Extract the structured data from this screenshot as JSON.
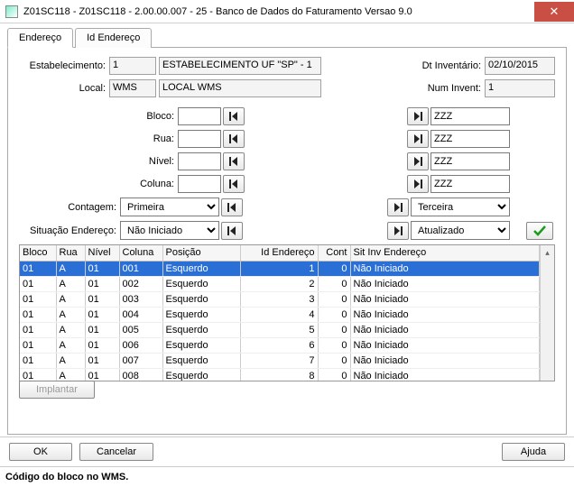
{
  "window": {
    "title": "Z01SC118 - Z01SC118 - 2.00.00.007 - 25 - Banco de Dados do Faturamento Versao 9.0"
  },
  "tabs": {
    "endereco": "Endereço",
    "id_endereco": "Id Endereço"
  },
  "labels": {
    "estabelecimento": "Estabelecimento:",
    "local": "Local:",
    "dt_inventario": "Dt Inventário:",
    "num_invent": "Num Invent:",
    "bloco": "Bloco:",
    "rua": "Rua:",
    "nivel": "Nível:",
    "coluna": "Coluna:",
    "contagem": "Contagem:",
    "situacao": "Situação Endereço:"
  },
  "values": {
    "estabelecimento_cod": "1",
    "estabelecimento_nome": "ESTABELECIMENTO UF \"SP\" - 1",
    "local_cod": "WMS",
    "local_nome": "LOCAL WMS",
    "dt_inventario": "02/10/2015",
    "num_invent": "1",
    "bloco_from": "",
    "bloco_to": "ZZZ",
    "rua_from": "",
    "rua_to": "ZZZ",
    "nivel_from": "",
    "nivel_to": "ZZZ",
    "coluna_from": "",
    "coluna_to": "ZZZ",
    "contagem_from": "Primeira",
    "contagem_to": "Terceira",
    "situacao_from": "Não Iniciado",
    "situacao_to": "Atualizado"
  },
  "table": {
    "headers": {
      "bloco": "Bloco",
      "rua": "Rua",
      "nivel": "Nível",
      "coluna": "Coluna",
      "posicao": "Posição",
      "id_endereco": "Id Endereço",
      "cont": "Cont",
      "sit_inv": "Sit Inv Endereço"
    },
    "rows": [
      {
        "bloco": "01",
        "rua": "A",
        "nivel": "01",
        "coluna": "001",
        "posicao": "Esquerdo",
        "id": "1",
        "cont": "0",
        "sit": "Não Iniciado"
      },
      {
        "bloco": "01",
        "rua": "A",
        "nivel": "01",
        "coluna": "002",
        "posicao": "Esquerdo",
        "id": "2",
        "cont": "0",
        "sit": "Não Iniciado"
      },
      {
        "bloco": "01",
        "rua": "A",
        "nivel": "01",
        "coluna": "003",
        "posicao": "Esquerdo",
        "id": "3",
        "cont": "0",
        "sit": "Não Iniciado"
      },
      {
        "bloco": "01",
        "rua": "A",
        "nivel": "01",
        "coluna": "004",
        "posicao": "Esquerdo",
        "id": "4",
        "cont": "0",
        "sit": "Não Iniciado"
      },
      {
        "bloco": "01",
        "rua": "A",
        "nivel": "01",
        "coluna": "005",
        "posicao": "Esquerdo",
        "id": "5",
        "cont": "0",
        "sit": "Não Iniciado"
      },
      {
        "bloco": "01",
        "rua": "A",
        "nivel": "01",
        "coluna": "006",
        "posicao": "Esquerdo",
        "id": "6",
        "cont": "0",
        "sit": "Não Iniciado"
      },
      {
        "bloco": "01",
        "rua": "A",
        "nivel": "01",
        "coluna": "007",
        "posicao": "Esquerdo",
        "id": "7",
        "cont": "0",
        "sit": "Não Iniciado"
      },
      {
        "bloco": "01",
        "rua": "A",
        "nivel": "01",
        "coluna": "008",
        "posicao": "Esquerdo",
        "id": "8",
        "cont": "0",
        "sit": "Não Iniciado"
      }
    ]
  },
  "buttons": {
    "implantar": "Implantar",
    "ok": "OK",
    "cancelar": "Cancelar",
    "ajuda": "Ajuda"
  },
  "status": "Código do bloco no WMS."
}
